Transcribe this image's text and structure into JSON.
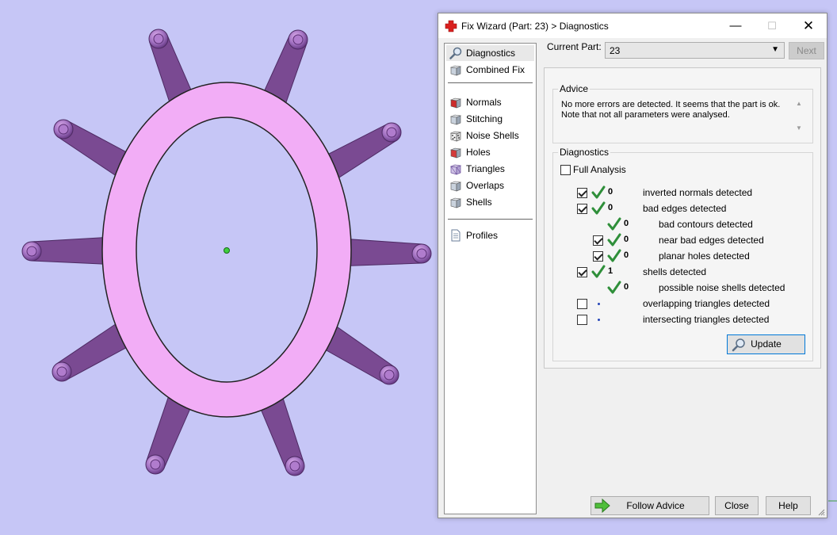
{
  "scene": {
    "background_color": "#c6c6f6",
    "ring_color": "#f2adf6",
    "spoke_color": "#7a4a92",
    "spoke_count": 10
  },
  "dialog": {
    "title": "Fix Wizard (Part: 23) > Diagnostics",
    "title_icon": "red-cross-icon",
    "minimize_glyph": "—",
    "maximize_glyph": "☐",
    "close_glyph": "✕",
    "nav": {
      "top": [
        {
          "label": "Diagnostics",
          "icon": "magnifier-icon",
          "selected": true
        },
        {
          "label": "Combined Fix",
          "icon": "part-icon"
        }
      ],
      "tools": [
        {
          "label": "Normals",
          "icon": "normals-icon"
        },
        {
          "label": "Stitching",
          "icon": "stitching-icon"
        },
        {
          "label": "Noise Shells",
          "icon": "noise-shells-icon"
        },
        {
          "label": "Holes",
          "icon": "holes-icon"
        },
        {
          "label": "Triangles",
          "icon": "triangles-icon"
        },
        {
          "label": "Overlaps",
          "icon": "overlaps-icon"
        },
        {
          "label": "Shells",
          "icon": "shells-icon"
        }
      ],
      "bottom": [
        {
          "label": "Profiles",
          "icon": "document-icon"
        }
      ]
    },
    "current_part_label": "Current Part:",
    "current_part_value": "23",
    "next_label": "Next",
    "advice": {
      "title": "Advice",
      "text": "No more errors are detected. It seems that the part is ok. Note that not all parameters were analysed."
    },
    "diagnostics": {
      "title": "Diagnostics",
      "full_analysis_label": "Full Analysis",
      "full_analysis_checked": false,
      "rows": [
        {
          "label": "inverted normals detected",
          "count": "0",
          "checked": true,
          "has_checkbox": true,
          "status": "ok",
          "indent": 0
        },
        {
          "label": "bad edges detected",
          "count": "0",
          "checked": true,
          "has_checkbox": true,
          "status": "ok",
          "indent": 0
        },
        {
          "label": "bad contours detected",
          "count": "0",
          "checked": false,
          "has_checkbox": false,
          "status": "ok",
          "indent": 1
        },
        {
          "label": "near bad edges detected",
          "count": "0",
          "checked": true,
          "has_checkbox": true,
          "status": "ok",
          "indent": 1
        },
        {
          "label": "planar holes detected",
          "count": "0",
          "checked": true,
          "has_checkbox": true,
          "status": "ok",
          "indent": 1
        },
        {
          "label": "shells detected",
          "count": "1",
          "checked": true,
          "has_checkbox": true,
          "status": "ok",
          "indent": 0
        },
        {
          "label": "possible noise shells detected",
          "count": "0",
          "checked": false,
          "has_checkbox": false,
          "status": "ok",
          "indent": 1
        },
        {
          "label": "overlapping triangles detected",
          "count": "",
          "checked": false,
          "has_checkbox": true,
          "status": "not-run",
          "indent": 0
        },
        {
          "label": "intersecting triangles detected",
          "count": "",
          "checked": false,
          "has_checkbox": true,
          "status": "not-run",
          "indent": 0
        }
      ],
      "update_label": "Update"
    },
    "follow_advice_label": "Follow Advice",
    "close_label": "Close",
    "help_label": "Help"
  }
}
